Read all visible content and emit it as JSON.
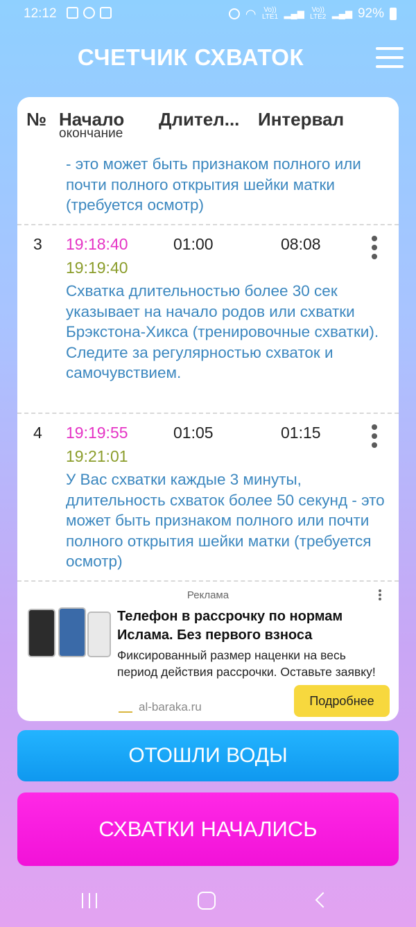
{
  "status_bar": {
    "time": "12:12",
    "network1": "Vo)) LTE1",
    "network2": "Vo)) LTE2",
    "battery": "92%"
  },
  "header": {
    "title": "СЧЕТЧИК СХВАТОК"
  },
  "table": {
    "headers": {
      "num": "№",
      "start": "Начало",
      "start_sub": "окончание",
      "duration": "Длител...",
      "interval": "Интервал"
    },
    "partial_note": "- это может быть признаком полного или почти полного открытия шейки матки (требуется осмотр)",
    "rows": [
      {
        "num": "3",
        "start": "19:18:40",
        "end": "19:19:40",
        "duration": "01:00",
        "interval": "08:08",
        "note": "Схватка длительностью более 30 сек указывает на начало родов или схватки Брэкстона-Хикса (тренировочные схватки). Следите за регулярностью схваток и самочувствием."
      },
      {
        "num": "4",
        "start": "19:19:55",
        "end": "19:21:01",
        "duration": "01:05",
        "interval": "01:15",
        "note": "У Вас схватки каждые 3 минуты, длительность схваток более 50 секунд - это может быть признаком полного или почти полного открытия шейки матки (требуется осмотр)"
      }
    ]
  },
  "ad": {
    "label": "Реклама",
    "title": "Телефон в рассрочку по нормам Ислама. Без первого взноса",
    "text": "Фиксированный размер наценки на весь период действия рассрочки. Оставьте заявку!",
    "site": "al-baraka.ru",
    "cta": "Подробнее"
  },
  "buttons": {
    "water": "ОТОШЛИ ВОДЫ",
    "contractions": "СХВАТКИ НАЧАЛИСЬ"
  },
  "colors": {
    "start_time": "#e533c5",
    "end_time": "#8b9d2b",
    "note": "#3b87bf",
    "water_button": "#0f98ef",
    "contractions_button": "#f212d8",
    "ad_cta": "#f7d83e"
  }
}
